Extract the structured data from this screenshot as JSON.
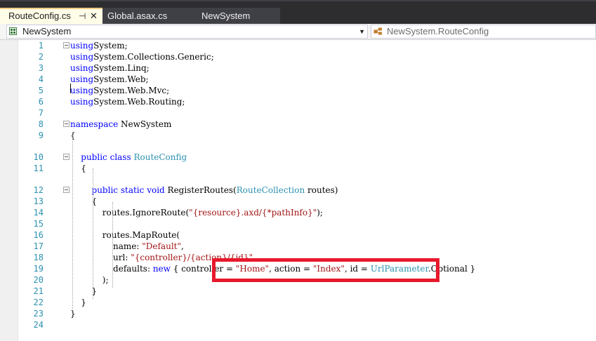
{
  "tabs": [
    {
      "label": "RouteConfig.cs",
      "pin": "⊣",
      "close": "✕"
    },
    {
      "label": "Global.asax.cs"
    },
    {
      "label": "NewSystem"
    }
  ],
  "navbar": {
    "project": "NewSystem",
    "class_member": "NewSystem.RouteConfig"
  },
  "lines": [
    {
      "n": "1",
      "collapse": true,
      "tokens": [
        [
          "kw",
          "using"
        ],
        [
          "",
          "System;"
        ]
      ]
    },
    {
      "n": "2",
      "tokens": [
        [
          "kw",
          "using"
        ],
        [
          "",
          "System.Collections.Generic;"
        ]
      ]
    },
    {
      "n": "3",
      "tokens": [
        [
          "kw",
          "using"
        ],
        [
          "",
          "System.Linq;"
        ]
      ]
    },
    {
      "n": "4",
      "tokens": [
        [
          "kw",
          "using"
        ],
        [
          "",
          "System.Web;"
        ]
      ]
    },
    {
      "n": "5",
      "tokens": [
        [
          "kw",
          "using"
        ],
        [
          "",
          "System.Web.Mvc;"
        ]
      ]
    },
    {
      "n": "6",
      "tokens": [
        [
          "kw",
          "using"
        ],
        [
          "",
          "System.Web.Routing;"
        ]
      ]
    },
    {
      "n": "7",
      "tokens": []
    },
    {
      "n": "8",
      "collapse": true,
      "tokens": [
        [
          "kw",
          "namespace"
        ],
        [
          "",
          " NewSystem"
        ]
      ]
    },
    {
      "n": "9",
      "tokens": [
        [
          "",
          "{"
        ]
      ]
    },
    {
      "n": "10",
      "collapse": true,
      "tokens": [
        [
          "",
          "    "
        ],
        [
          "kw",
          "public"
        ],
        [
          "",
          " "
        ],
        [
          "kw",
          "class"
        ],
        [
          "",
          " "
        ],
        [
          "ty",
          "RouteConfig"
        ]
      ]
    },
    {
      "n": "11",
      "tokens": [
        [
          "",
          "    {"
        ]
      ]
    },
    {
      "n": "12",
      "collapse": true,
      "tokens": [
        [
          "",
          "        "
        ],
        [
          "kw",
          "public"
        ],
        [
          "",
          " "
        ],
        [
          "kw",
          "static"
        ],
        [
          "",
          " "
        ],
        [
          "kw",
          "void"
        ],
        [
          "",
          " RegisterRoutes("
        ],
        [
          "ty",
          "RouteCollection"
        ],
        [
          "",
          " routes)"
        ]
      ]
    },
    {
      "n": "13",
      "tokens": [
        [
          "",
          "        {"
        ]
      ]
    },
    {
      "n": "14",
      "tokens": [
        [
          "",
          "            routes.IgnoreRoute("
        ],
        [
          "st",
          "\"{resource}.axd/{*pathInfo}\""
        ],
        [
          "",
          ");"
        ]
      ]
    },
    {
      "n": "15",
      "tokens": []
    },
    {
      "n": "16",
      "tokens": [
        [
          "",
          "            routes.MapRoute("
        ]
      ]
    },
    {
      "n": "17",
      "tokens": [
        [
          "",
          "                name: "
        ],
        [
          "st",
          "\"Default\""
        ],
        [
          "",
          ","
        ]
      ]
    },
    {
      "n": "18",
      "tokens": [
        [
          "",
          "                url: "
        ],
        [
          "st",
          "\"{controller}/{action}/{id}\""
        ],
        [
          "",
          ","
        ]
      ]
    },
    {
      "n": "19",
      "tokens": [
        [
          "",
          "                defaults: "
        ],
        [
          "kw",
          "new"
        ],
        [
          "",
          " { controller = "
        ],
        [
          "st",
          "\"Home\""
        ],
        [
          "",
          ", action = "
        ],
        [
          "st",
          "\"Index\""
        ],
        [
          "",
          ", id = "
        ],
        [
          "ty",
          "UrlParameter"
        ],
        [
          "",
          ".Optional }"
        ]
      ]
    },
    {
      "n": "20",
      "tokens": [
        [
          "",
          "            );"
        ]
      ]
    },
    {
      "n": "21",
      "tokens": [
        [
          "",
          "        }"
        ]
      ]
    },
    {
      "n": "22",
      "tokens": [
        [
          "",
          "    }"
        ]
      ]
    },
    {
      "n": "23",
      "tokens": [
        [
          "",
          "}"
        ]
      ]
    },
    {
      "n": "24",
      "tokens": []
    }
  ],
  "colors": {
    "keyword": "#0000ff",
    "type": "#2b91af",
    "string": "#a31515",
    "highlight_box": "#e8192c",
    "change_margin": "#f0f0f0"
  }
}
